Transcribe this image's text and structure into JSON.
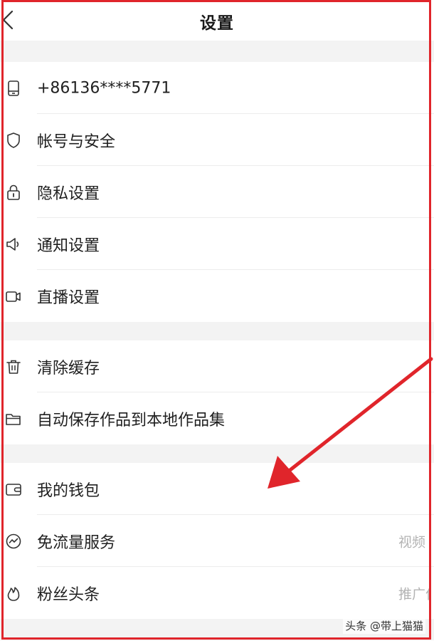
{
  "header": {
    "title": "设置"
  },
  "groups": [
    {
      "items": [
        {
          "label": "+86136****5771",
          "icon": "phone-icon"
        },
        {
          "label": "帐号与安全",
          "icon": "shield-icon"
        },
        {
          "label": "隐私设置",
          "icon": "lock-icon"
        },
        {
          "label": "通知设置",
          "icon": "speaker-icon"
        },
        {
          "label": "直播设置",
          "icon": "camera-icon"
        }
      ]
    },
    {
      "items": [
        {
          "label": "清除缓存",
          "icon": "trash-icon"
        },
        {
          "label": "自动保存作品到本地作品集",
          "icon": "folder-icon"
        }
      ]
    },
    {
      "items": [
        {
          "label": "我的钱包",
          "icon": "wallet-icon"
        },
        {
          "label": "免流量服务",
          "icon": "data-plan-icon",
          "trailing": "视频"
        },
        {
          "label": "粉丝头条",
          "icon": "flame-icon",
          "trailing": "推广作品"
        }
      ]
    }
  ],
  "watermark": "头条 @带上猫猫",
  "colors": {
    "annotation_red": "#e0252b",
    "section_gap": "#f3f3f3",
    "divider": "#ececec"
  }
}
